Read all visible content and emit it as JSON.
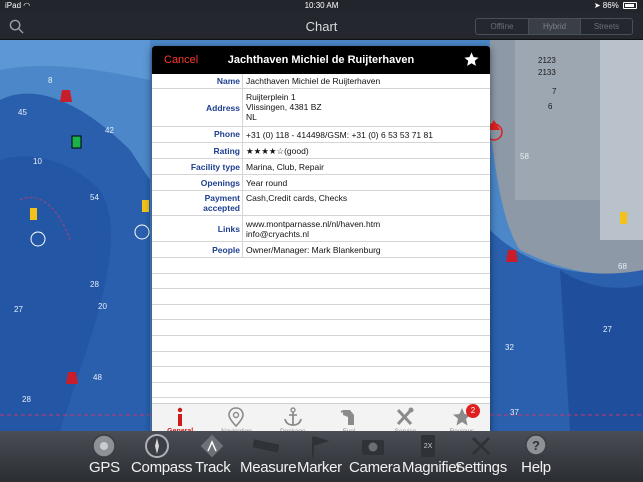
{
  "status_bar": {
    "device": "iPad",
    "time": "10:30 AM",
    "battery": "86%"
  },
  "nav": {
    "title": "Chart",
    "map_modes": [
      "Offline",
      "Hybrid",
      "Streets"
    ],
    "selected_mode": "Hybrid"
  },
  "map": {
    "depths": [
      "45",
      "42",
      "10",
      "54",
      "28",
      "20",
      "27",
      "28",
      "48",
      "32",
      "68",
      "27",
      "37",
      "2123",
      "2133",
      "7",
      "58",
      "6",
      "8"
    ]
  },
  "modal": {
    "cancel": "Cancel",
    "title": "Jachthaven Michiel de Ruijterhaven",
    "rows": [
      {
        "label": "Name",
        "value": "Jachthaven Michiel de Ruijterhaven"
      },
      {
        "label": "Address",
        "value_lines": [
          "Ruijterplein 1",
          "Vlissingen, 4381 BZ",
          "NL"
        ]
      },
      {
        "label": "Phone",
        "value": "+31 (0) 118 - 414498/GSM: +31 (0) 6 53 53 71 81"
      },
      {
        "label": "Rating",
        "value": "★★★★☆(good)"
      },
      {
        "label": "Facility type",
        "value": "Marina, Club, Repair"
      },
      {
        "label": "Openings",
        "value": "Year round"
      },
      {
        "label_lines": [
          "Payment",
          "accepted"
        ],
        "value": "Cash,Credit cards, Checks"
      },
      {
        "label": "Links",
        "value_lines": [
          "www.montparnasse.nl/nl/haven.htm",
          "info@cryachts.nl"
        ]
      },
      {
        "label": "People",
        "value": "Owner/Manager: Mark Blankenburg"
      }
    ],
    "tabs": [
      {
        "label": "General",
        "icon": "info-icon",
        "active": true
      },
      {
        "label": "Navigation",
        "icon": "location-pin-icon"
      },
      {
        "label": "Dockage",
        "icon": "anchor-icon"
      },
      {
        "label": "Fuel",
        "icon": "fuel-nozzle-icon"
      },
      {
        "label": "Service",
        "icon": "tools-icon"
      },
      {
        "label": "Reviews",
        "icon": "star-icon",
        "badge": "2"
      }
    ]
  },
  "toolbar": {
    "items": [
      {
        "label": "GPS",
        "icon": "gps-icon"
      },
      {
        "label": "Compass",
        "icon": "compass-icon"
      },
      {
        "label": "Track",
        "icon": "track-icon"
      },
      {
        "label": "Measure",
        "icon": "ruler-icon"
      },
      {
        "label": "Marker",
        "icon": "marker-icon"
      },
      {
        "label": "Camera",
        "icon": "camera-icon"
      },
      {
        "label": "Magnifier",
        "icon": "magnifier-icon"
      },
      {
        "label": "Settings",
        "icon": "settings-icon"
      },
      {
        "label": "Help",
        "icon": "help-icon"
      }
    ]
  },
  "colors": {
    "accent_red": "#ff3b30",
    "label_blue": "#1d3f8f",
    "water": "#4b87c9",
    "deep_water": "#2a5fae"
  }
}
